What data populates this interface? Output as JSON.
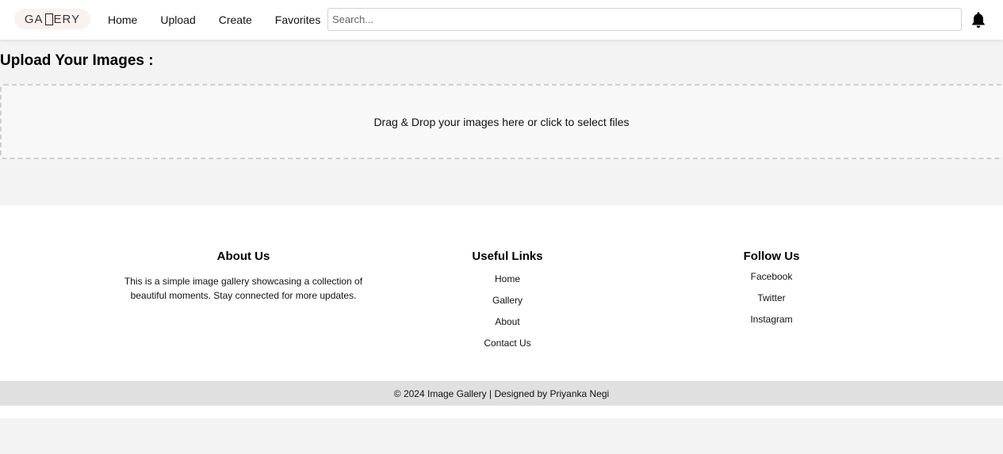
{
  "header": {
    "logo_prefix": "GA",
    "logo_suffix": "ERY",
    "nav": [
      {
        "label": "Home"
      },
      {
        "label": "Upload"
      },
      {
        "label": "Create"
      },
      {
        "label": "Favorites"
      }
    ],
    "search_placeholder": "Search...",
    "search_value": "",
    "notification_icon": "bell-icon"
  },
  "main": {
    "title": "Upload Your Images :",
    "dropzone_text": "Drag & Drop your images here or click to select files"
  },
  "footer": {
    "about": {
      "heading": "About Us",
      "text": "This is a simple image gallery showcasing a collection of beautiful moments. Stay connected for more updates."
    },
    "useful_links": {
      "heading": "Useful Links",
      "items": [
        "Home",
        "Gallery",
        "About",
        "Contact Us"
      ]
    },
    "follow": {
      "heading": "Follow Us",
      "items": [
        "Facebook",
        "Twitter",
        "Instagram"
      ]
    },
    "copyright": "© 2024 Image Gallery | Designed by Priyanka Negi"
  },
  "colors": {
    "page_background": "#f3f3f3",
    "header_background": "#ffffff",
    "logo_background": "#fbf1ef",
    "copyright_background": "#e0e0e0"
  }
}
